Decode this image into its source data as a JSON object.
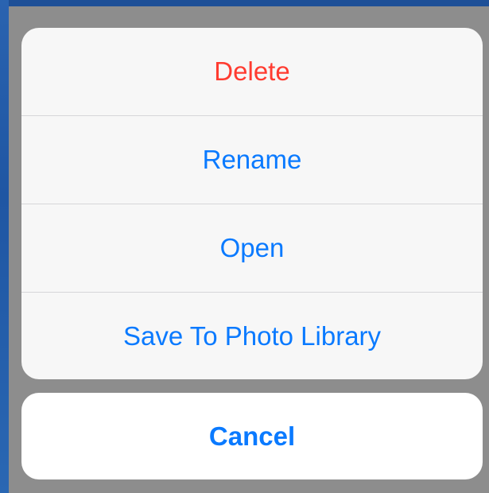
{
  "action_sheet": {
    "actions": [
      {
        "label": "Delete",
        "style": "destructive",
        "color": "#ff3b30"
      },
      {
        "label": "Rename",
        "style": "default",
        "color": "#0a7aff"
      },
      {
        "label": "Open",
        "style": "default",
        "color": "#0a7aff"
      },
      {
        "label": "Save To Photo Library",
        "style": "default",
        "color": "#0a7aff"
      }
    ],
    "cancel": {
      "label": "Cancel",
      "style": "cancel",
      "color": "#0a7aff"
    }
  },
  "colors": {
    "dim_overlay": "#8d8d8d",
    "sheet_background": "#f7f7f7",
    "separator": "#d6d6d9",
    "wallpaper_blue": "#2a63b0"
  }
}
